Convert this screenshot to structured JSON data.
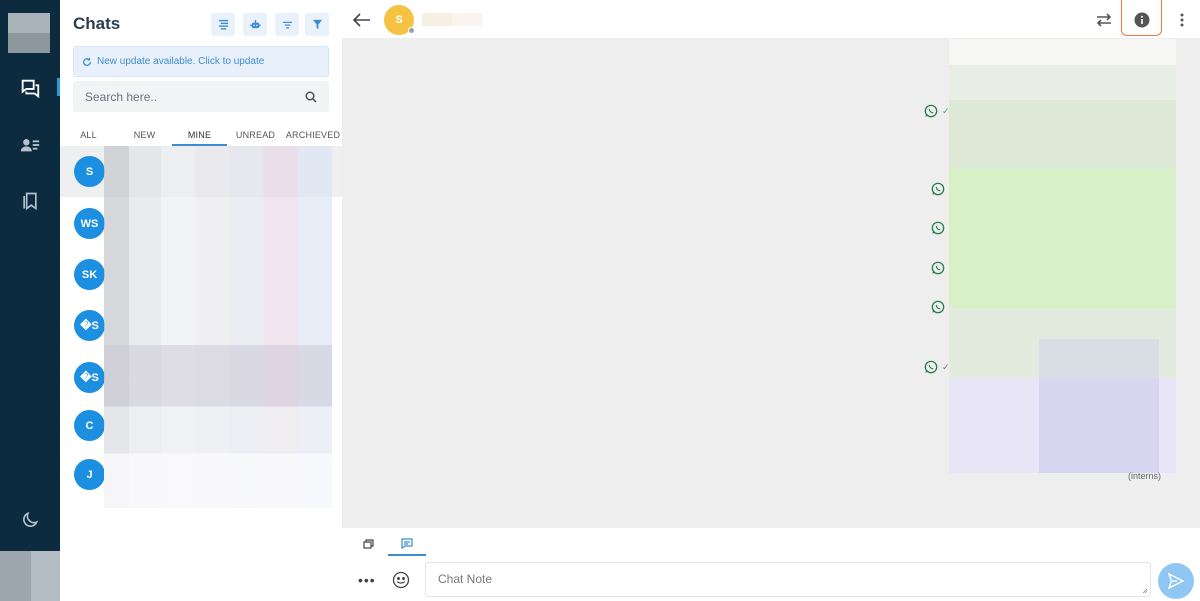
{
  "panel": {
    "title": "Chats",
    "update_banner": "New update available. Click to update",
    "search_placeholder": "Search here..",
    "tabs": [
      {
        "label": "ALL"
      },
      {
        "label": "NEW"
      },
      {
        "label": "MINE",
        "active": true
      },
      {
        "label": "UNREAD"
      },
      {
        "label": "ARCHIEVED"
      }
    ],
    "chats": [
      {
        "initials": "S",
        "selected": true
      },
      {
        "initials": "WS"
      },
      {
        "initials": "SK"
      },
      {
        "initials": "�S"
      },
      {
        "initials": "�S"
      },
      {
        "initials": "C"
      },
      {
        "initials": "J"
      }
    ]
  },
  "header": {
    "contact_initial": "S"
  },
  "conversation": {
    "footer_label": "(interns)"
  },
  "composer": {
    "placeholder": "Chat Note",
    "more_label": "•••"
  },
  "colors": {
    "rail": "#0d2b3e",
    "accent": "#1d8fe1",
    "highlight": "#f07a3c",
    "whatsapp": "#25a244"
  }
}
